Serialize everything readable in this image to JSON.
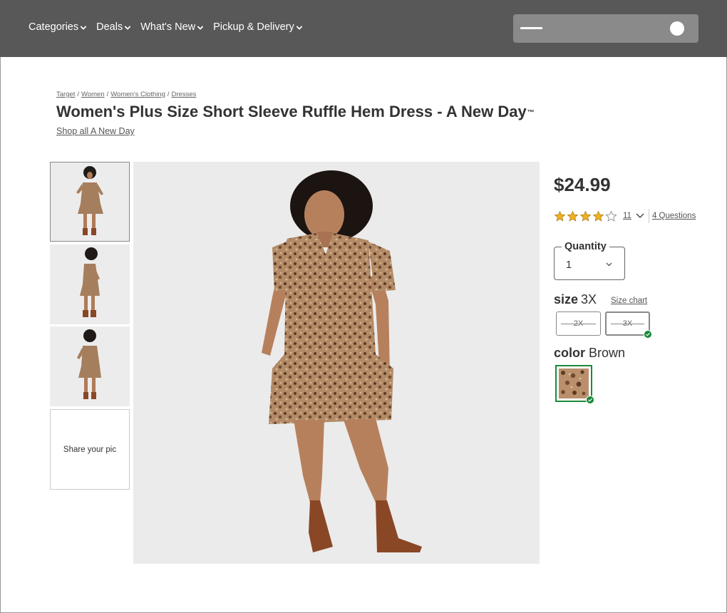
{
  "nav": {
    "items": [
      {
        "label": "Categories"
      },
      {
        "label": "Deals"
      },
      {
        "label": "What's New"
      },
      {
        "label": "Pickup & Delivery"
      }
    ]
  },
  "breadcrumb": {
    "items": [
      "Target",
      "Women",
      "Women's Clothing",
      "Dresses"
    ],
    "separator": "/"
  },
  "product": {
    "title": "Women's Plus Size Short Sleeve Ruffle Hem Dress - A New Day",
    "trademark": "™",
    "brand_link": "Shop all A New Day",
    "price": "$24.99",
    "rating": 4,
    "rating_max": 5,
    "review_count": "11",
    "questions_link": "4 Questions"
  },
  "gallery": {
    "share_label": "Share your pic"
  },
  "quantity": {
    "label": "Quantity",
    "value": "1"
  },
  "size": {
    "label": "size",
    "selected": "3X",
    "chart_link": "Size chart",
    "options": [
      "2X",
      "3X"
    ]
  },
  "color": {
    "label": "color",
    "selected": "Brown"
  },
  "colors": {
    "header_bg": "#585858",
    "success": "#1a8a3a",
    "star": "#f2b01e"
  }
}
